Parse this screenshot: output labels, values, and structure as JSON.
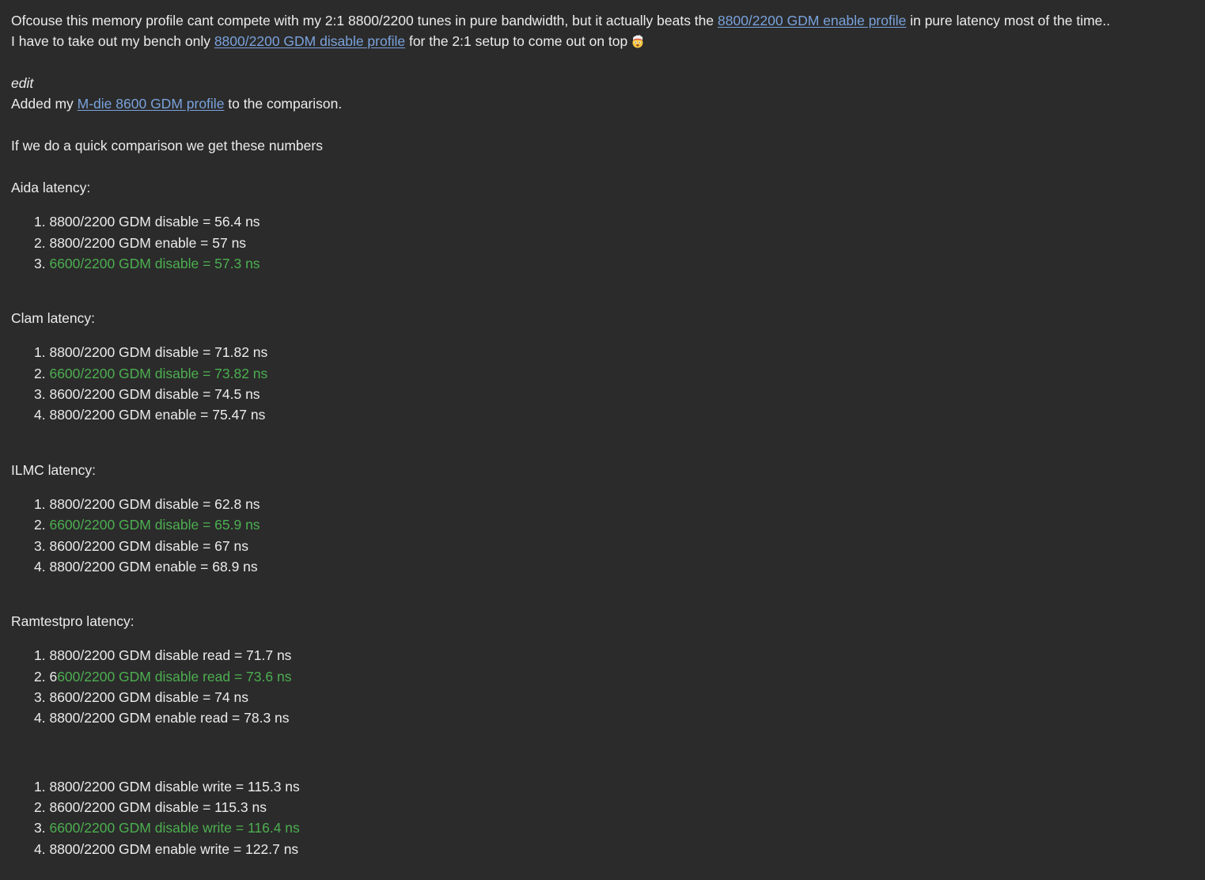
{
  "intro": {
    "line1_pre": "Ofcouse this memory profile cant compete with my 2:1 8800/2200 tunes in pure bandwidth, but it actually beats the ",
    "line1_link": "8800/2200 GDM enable profile",
    "line1_post": " in pure latency most of the time..",
    "line2_pre": "I have to take out my bench only ",
    "line2_link": "8800/2200 GDM disable profile",
    "line2_post": " for the 2:1 setup to come out on top",
    "emoji": "exploding-head-icon"
  },
  "edit": {
    "label": "edit",
    "added_pre": "Added my ",
    "added_link": "M-die 8600 GDM profile",
    "added_post": " to the comparison."
  },
  "summary": "If we do a quick comparison we get these numbers",
  "colors": {
    "text": "#ececec",
    "link": "#7aa2dc",
    "highlight": "#4caf50",
    "background": "#2b2b2b"
  },
  "sections": {
    "aida": {
      "heading": "Aida latency:",
      "items": [
        {
          "num": "1. ",
          "pre": "",
          "hl": "",
          "text": "8800/2200 GDM disable = 56.4 ns"
        },
        {
          "num": "2. ",
          "pre": "",
          "hl": "",
          "text": "8800/2200 GDM enable = 57 ns"
        },
        {
          "num": "3. ",
          "pre": "",
          "hl": "6600/2200 GDM disable = 57.3 ns",
          "text": ""
        }
      ]
    },
    "clam": {
      "heading": "Clam latency:",
      "items": [
        {
          "num": "1. ",
          "pre": "",
          "hl": "",
          "text": "8800/2200 GDM disable = 71.82 ns"
        },
        {
          "num": "2. ",
          "pre": "",
          "hl": "6600/2200 GDM disable = 73.82 ns",
          "text": ""
        },
        {
          "num": "3. ",
          "pre": "",
          "hl": "",
          "text": "8600/2200 GDM disable = 74.5 ns"
        },
        {
          "num": "4. ",
          "pre": "",
          "hl": "",
          "text": "8800/2200 GDM enable = 75.47 ns"
        }
      ]
    },
    "ilmc": {
      "heading": "ILMC latency:",
      "items": [
        {
          "num": "1. ",
          "pre": "",
          "hl": "",
          "text": "8800/2200 GDM disable = 62.8 ns"
        },
        {
          "num": "2. ",
          "pre": "",
          "hl": "6600/2200 GDM disable = 65.9 ns",
          "text": ""
        },
        {
          "num": "3. ",
          "pre": "",
          "hl": "",
          "text": "8600/2200 GDM disable = 67 ns"
        },
        {
          "num": "4. ",
          "pre": "",
          "hl": "",
          "text": "8800/2200 GDM enable = 68.9 ns"
        }
      ]
    },
    "ramtest": {
      "heading": "Ramtestpro latency:",
      "items": [
        {
          "num": "1. ",
          "pre": "",
          "hl": "",
          "text": "8800/2200 GDM disable read = 71.7 ns"
        },
        {
          "num": "2. ",
          "pre": "6",
          "hl": "600/2200 GDM disable read = 73.6 ns",
          "text": ""
        },
        {
          "num": "3. ",
          "pre": "",
          "hl": "",
          "text": "8600/2200 GDM disable = 74 ns"
        },
        {
          "num": "4. ",
          "pre": "",
          "hl": "",
          "text": "8800/2200 GDM enable read = 78.3 ns"
        }
      ]
    },
    "ramtest_write": {
      "items": [
        {
          "num": "1. ",
          "pre": "",
          "hl": "",
          "text": "8800/2200 GDM disable write = 115.3 ns"
        },
        {
          "num": "2. ",
          "pre": "",
          "hl": "",
          "text": "8600/2200 GDM disable = 115.3 ns"
        },
        {
          "num": "3. ",
          "pre": "",
          "hl": "6600/2200 GDM disable write = 116.4 ns",
          "text": ""
        },
        {
          "num": "4. ",
          "pre": "",
          "hl": "",
          "text": "8800/2200 GDM enable write = 122.7 ns"
        }
      ]
    }
  }
}
